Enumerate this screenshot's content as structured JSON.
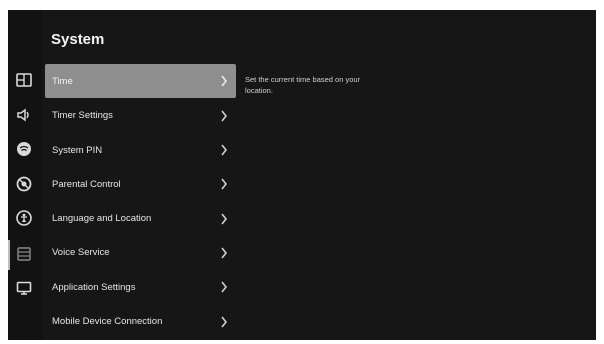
{
  "page": {
    "title": "System"
  },
  "menu": {
    "items": [
      {
        "label": "Time",
        "selected": true
      },
      {
        "label": "Timer Settings",
        "selected": false
      },
      {
        "label": "System PIN",
        "selected": false
      },
      {
        "label": "Parental Control",
        "selected": false
      },
      {
        "label": "Language and Location",
        "selected": false
      },
      {
        "label": "Voice Service",
        "selected": false
      },
      {
        "label": "Application Settings",
        "selected": false
      },
      {
        "label": "Mobile Device Connection",
        "selected": false
      }
    ]
  },
  "description": {
    "text": "Set the current time based on your location."
  },
  "rail": {
    "icons": [
      "picture-icon",
      "sound-icon",
      "network-icon",
      "support-icon",
      "accessibility-icon",
      "system-icon",
      "display-icon"
    ],
    "active": "system-icon"
  },
  "colors": {
    "background": "#161616",
    "selected_item": "#8e8e8e",
    "text": "#e6e6e6"
  }
}
